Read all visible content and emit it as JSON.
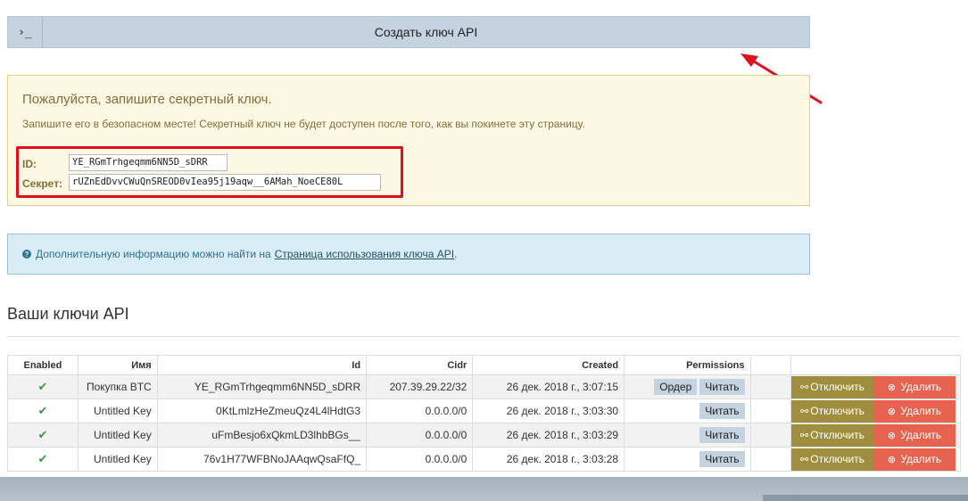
{
  "toolbar": {
    "terminal_glyph": "›_",
    "create_label": "Создать ключ API"
  },
  "notice": {
    "heading": "Пожалуйста, запишите секретный ключ.",
    "subtext": "Запишите его в безопасном месте! Секретный ключ не будет доступен после того, как вы покинете эту страницу.",
    "id_label": "ID:",
    "id_value": "YE_RGmTrhgeqmm6NN5D_sDRR",
    "secret_label": "Секрет:",
    "secret_value": "rUZnEdDvvCWuQnSREOD0vIea95j19aqw__6AMah_NoeCE80L"
  },
  "info": {
    "text": "Дополнительную информацию можно найти на",
    "link": "Страница использования ключа API",
    "suffix": "."
  },
  "keys": {
    "title": "Ваши ключи API",
    "columns": {
      "enabled": "Enabled",
      "name": "Имя",
      "id": "Id",
      "cidr": "Cidr",
      "created": "Created",
      "permissions": "Permissions"
    },
    "rows": [
      {
        "enabled": "✔",
        "name": "Покупка BTC",
        "id": "YE_RGmTrhgeqmm6NN5D_sDRR",
        "cidr": "207.39.29.22/32",
        "created": "26 дек. 2018 г., 3:07:15",
        "perm1": "Ордер",
        "perm2": "Читать",
        "disable": "Отключить",
        "delete": "Удалить"
      },
      {
        "enabled": "✔",
        "name": "Untitled Key",
        "id": "0KtLmlzHeZmeuQz4L4lHdtG3",
        "cidr": "0.0.0.0/0",
        "created": "26 дек. 2018 г., 3:03:30",
        "perm1": "",
        "perm2": "Читать",
        "disable": "Отключить",
        "delete": "Удалить"
      },
      {
        "enabled": "✔",
        "name": "Untitled Key",
        "id": "uFmBesjo6xQkmLD3lhbBGs__",
        "cidr": "0.0.0.0/0",
        "created": "26 дек. 2018 г., 3:03:29",
        "perm1": "",
        "perm2": "Читать",
        "disable": "Отключить",
        "delete": "Удалить"
      },
      {
        "enabled": "✔",
        "name": "Untitled Key",
        "id": "76v1H77WFBNoJAAqwQsaFfQ_",
        "cidr": "0.0.0.0/0",
        "created": "26 дек. 2018 г., 3:03:28",
        "perm1": "",
        "perm2": "Читать",
        "disable": "Отключить",
        "delete": "Удалить"
      }
    ]
  },
  "colors": {
    "accent_arrow": "#e0101b",
    "disable_button": "#9e8e3d",
    "delete_button": "#e8634f",
    "warning_bg": "#fcf8e3",
    "info_bg": "#d9edf7"
  }
}
